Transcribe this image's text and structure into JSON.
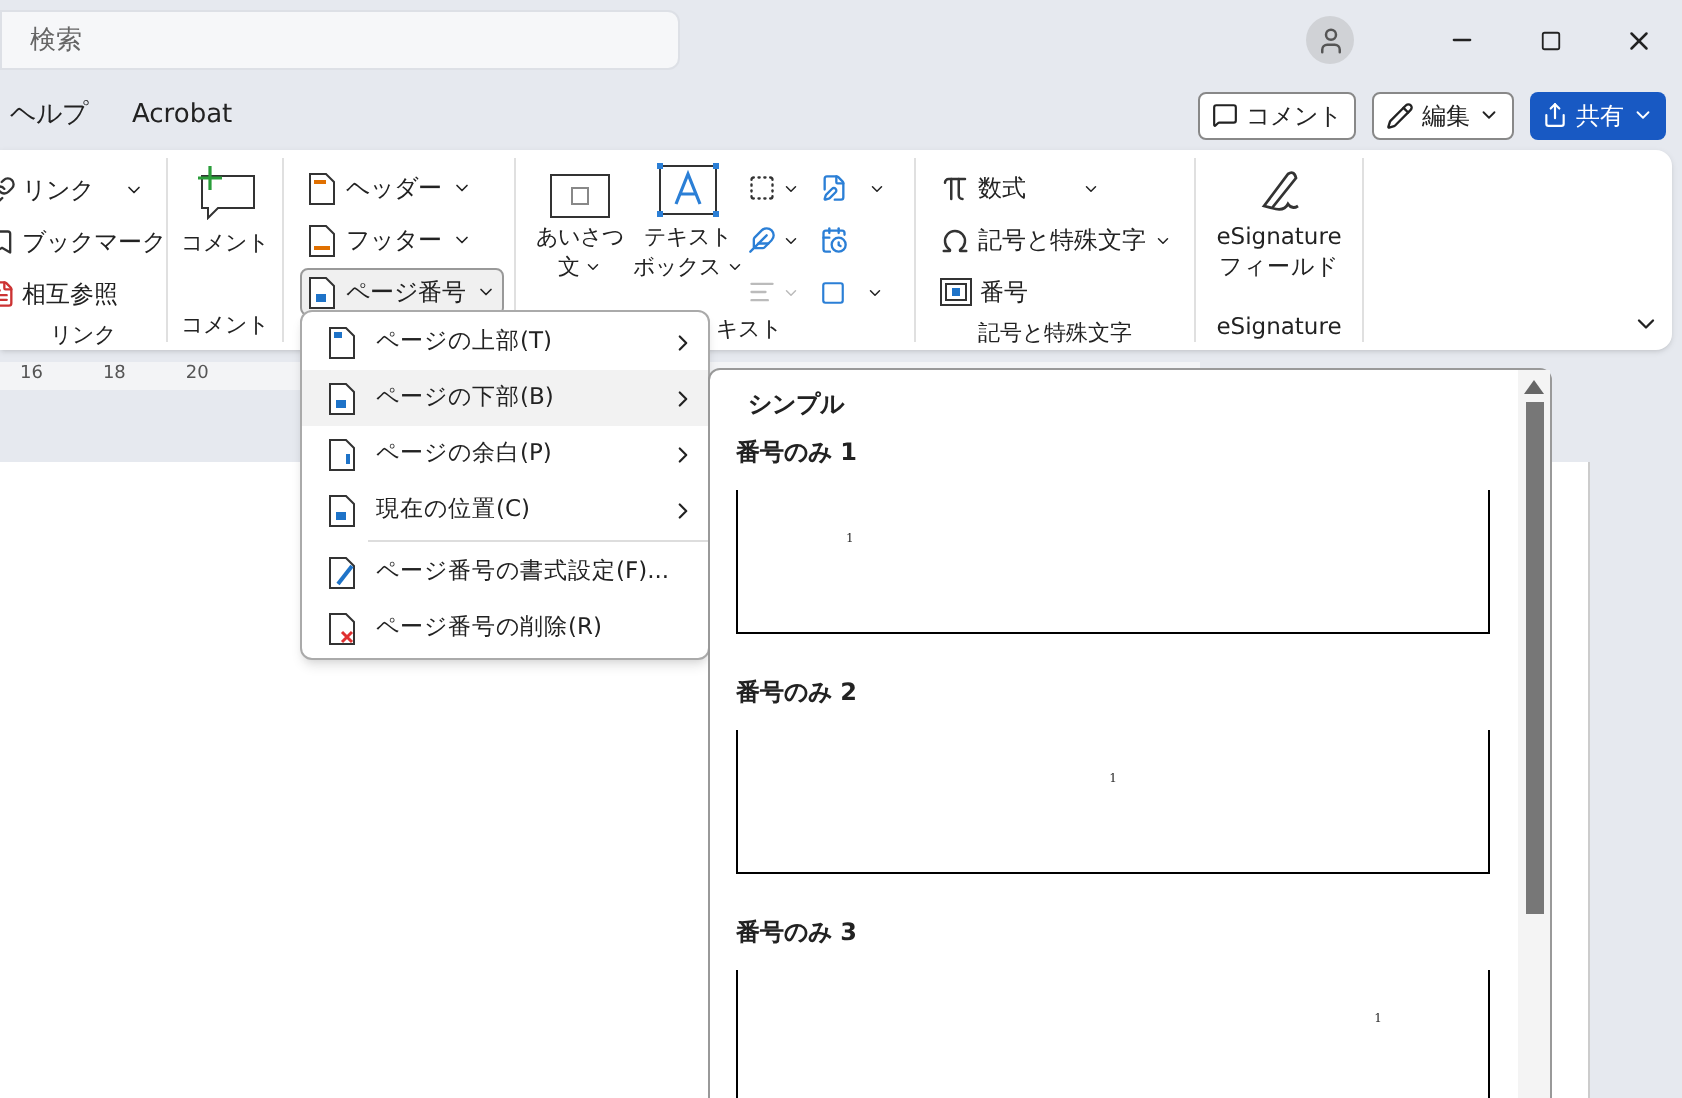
{
  "search": {
    "placeholder": "検索"
  },
  "tabs": [
    {
      "label": "ヘルプ"
    },
    {
      "label": "Acrobat"
    }
  ],
  "header_buttons": [
    {
      "label": "コメント",
      "kind": "comment"
    },
    {
      "label": "編集",
      "kind": "edit"
    },
    {
      "label": "共有",
      "kind": "share"
    }
  ],
  "ribbon": {
    "link_group": {
      "items": [
        {
          "label": "リンク",
          "kind": "link"
        },
        {
          "label": "ブックマーク",
          "kind": "bookmark"
        },
        {
          "label": "相互参照",
          "kind": "crossref"
        }
      ],
      "label": "リンク"
    },
    "comment_group": {
      "button": "コメント",
      "label": "コメント"
    },
    "header_footer_group": {
      "items": [
        {
          "label": "ヘッダー",
          "kind": "header",
          "pressed": false
        },
        {
          "label": "フッター",
          "kind": "footer",
          "pressed": false
        },
        {
          "label": "ページ番号",
          "kind": "page-number",
          "pressed": true
        }
      ]
    },
    "text_group": {
      "large_buttons": [
        {
          "lines": [
            "あいさつ",
            "文"
          ],
          "kind": "greeting"
        },
        {
          "lines": [
            "テキスト",
            "ボックス"
          ],
          "kind": "textbox"
        }
      ],
      "label": "キスト"
    },
    "symbols_group": {
      "items": [
        {
          "label": "数式",
          "kind": "equation"
        },
        {
          "label": "記号と特殊文字",
          "kind": "symbol"
        },
        {
          "label": "番号",
          "kind": "number"
        }
      ],
      "label": "記号と特殊文字"
    },
    "esignature_group": {
      "button_lines": [
        "eSignature",
        "フィールド"
      ],
      "label": "eSignature"
    }
  },
  "ruler": {
    "labels": [
      "16",
      "18",
      "20"
    ]
  },
  "page_number_menu": {
    "sections": [
      [
        {
          "label": "ページの上部(T)",
          "kind": "top",
          "selected": false
        },
        {
          "label": "ページの下部(B)",
          "kind": "bottom",
          "selected": true
        },
        {
          "label": "ページの余白(P)",
          "kind": "margin",
          "selected": false
        },
        {
          "label": "現在の位置(C)",
          "kind": "current",
          "selected": false
        }
      ],
      [
        {
          "label": "ページ番号の書式設定(F)...",
          "kind": "format",
          "selected": false
        },
        {
          "label": "ページ番号の削除(R)",
          "kind": "remove",
          "selected": false
        }
      ]
    ]
  },
  "gallery": {
    "heading": "シンプル",
    "items": [
      {
        "title": "番号のみ 1",
        "kind": "left",
        "number": "1"
      },
      {
        "title": "番号のみ 2",
        "kind": "center",
        "number": "1"
      },
      {
        "title": "番号のみ 3",
        "kind": "right",
        "number": "1"
      }
    ]
  }
}
